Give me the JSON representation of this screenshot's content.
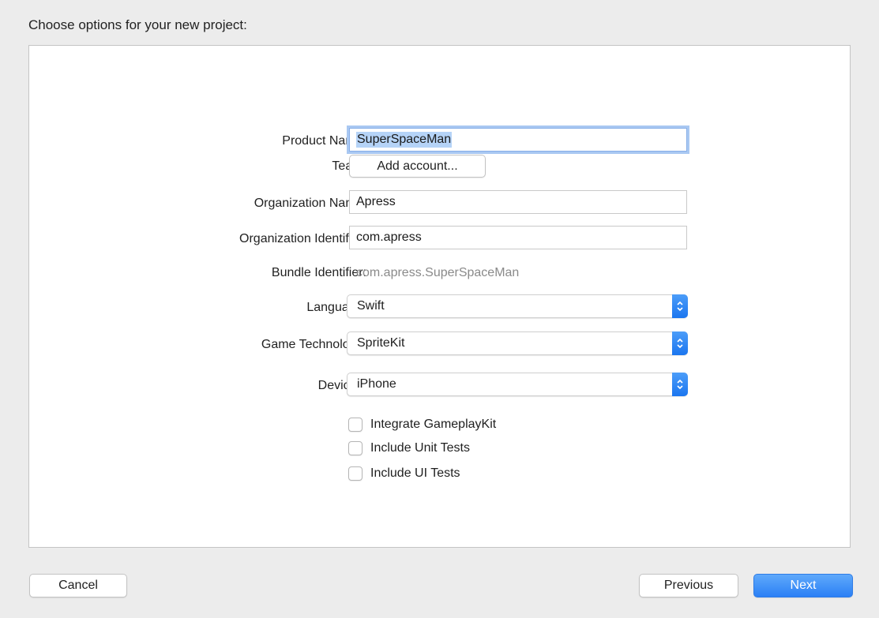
{
  "sheet": {
    "title": "Choose options for your new project:"
  },
  "form": {
    "product_name": {
      "label": "Product Name:",
      "value": "SuperSpaceMan"
    },
    "team": {
      "label": "Team:",
      "button_label": "Add account..."
    },
    "organization_name": {
      "label": "Organization Name:",
      "value": "Apress"
    },
    "organization_identifier": {
      "label": "Organization Identifier:",
      "value": "com.apress"
    },
    "bundle_identifier": {
      "label": "Bundle Identifier:",
      "value": "com.apress.SuperSpaceMan"
    },
    "language": {
      "label": "Language:",
      "value": "Swift"
    },
    "game_technology": {
      "label": "Game Technology:",
      "value": "SpriteKit"
    },
    "devices": {
      "label": "Devices:",
      "value": "iPhone"
    },
    "checkboxes": [
      {
        "label": "Integrate GameplayKit",
        "checked": false
      },
      {
        "label": "Include Unit Tests",
        "checked": false
      },
      {
        "label": "Include UI Tests",
        "checked": false
      }
    ]
  },
  "footer": {
    "cancel_label": "Cancel",
    "previous_label": "Previous",
    "next_label": "Next"
  },
  "colors": {
    "accent": "#2b80f5",
    "focus_ring": "#a9c8f2",
    "selection": "#b5d3f7",
    "background": "#ececec"
  }
}
